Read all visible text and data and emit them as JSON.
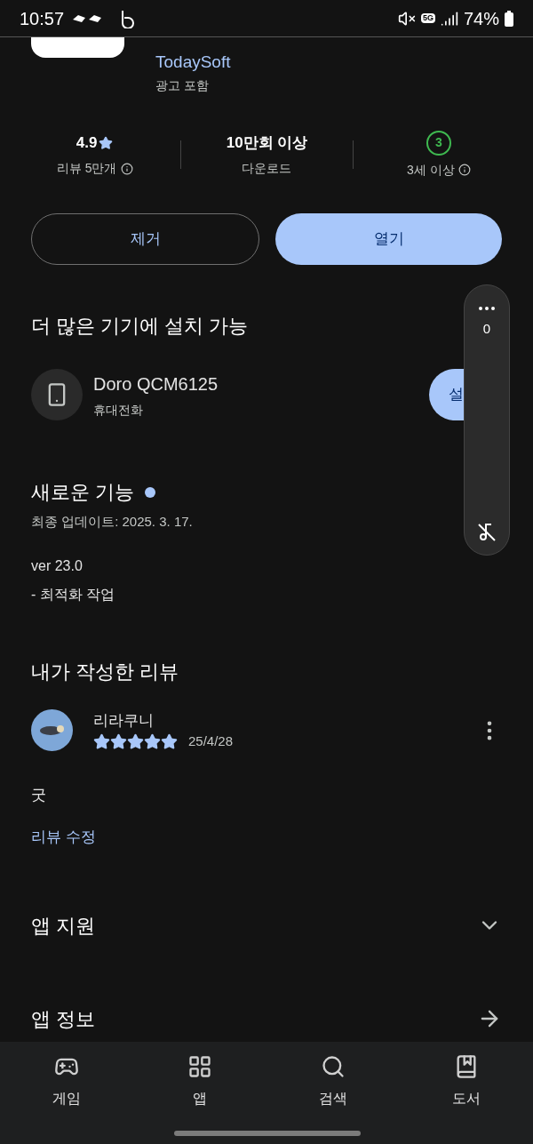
{
  "status_bar": {
    "time": "10:57",
    "battery": "74%",
    "network": "5G"
  },
  "app": {
    "developer": "TodaySoft",
    "ads_note": "광고 포함"
  },
  "stats": [
    {
      "kind": "rating",
      "value": "4.9",
      "label": "리뷰 5만개",
      "info": true
    },
    {
      "kind": "text",
      "value": "10만회 이상",
      "label": "다운로드",
      "info": false
    },
    {
      "kind": "age",
      "value": "3",
      "label": "3세 이상",
      "info": true
    }
  ],
  "actions": [
    {
      "kind": "outline",
      "label": "제거"
    },
    {
      "kind": "filled",
      "label": "열기"
    }
  ],
  "devices_section": {
    "title": "더 많은 기기에 설치 가능",
    "device": {
      "name": "Doro QCM6125",
      "type": "휴대전화",
      "button": "설"
    }
  },
  "whats_new": {
    "title": "새로운 기능",
    "new_dot": true,
    "updated": "최종 업데이트: 2025. 3. 17.",
    "notes": [
      "ver 23.0",
      "- 최적화 작업"
    ]
  },
  "my_review": {
    "title": "내가 작성한 리뷰",
    "author": "리라쿠니",
    "stars": 5,
    "date": "25/4/28",
    "text": "굿",
    "edit_link": "리뷰 수정"
  },
  "sections": [
    {
      "title": "앱 지원",
      "kind": "expand"
    },
    {
      "title": "앱 정보",
      "kind": "arrow"
    }
  ],
  "floating_panel": {
    "count": "0"
  },
  "bottom_nav": [
    {
      "kind": "games",
      "label": "게임"
    },
    {
      "kind": "apps",
      "label": "앱"
    },
    {
      "kind": "search",
      "label": "검색"
    },
    {
      "kind": "books",
      "label": "도서"
    }
  ]
}
